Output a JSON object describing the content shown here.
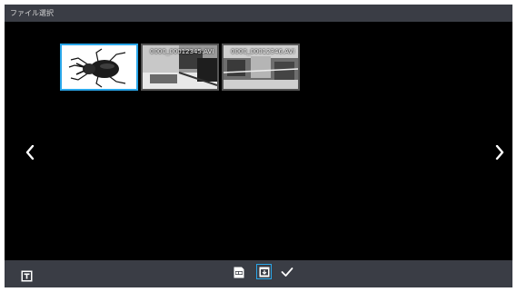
{
  "window": {
    "title": "ファイル選択"
  },
  "thumbnails": [
    {
      "name": "beetle",
      "caption": "",
      "selected": true
    },
    {
      "name": "video-1",
      "caption": "0000_00012345.AVI",
      "selected": false
    },
    {
      "name": "video-2",
      "caption": "0000_00012346.AVI",
      "selected": false
    }
  ],
  "toolbar": {
    "text_icon": "text-mode-icon",
    "sd_icon": "sd-card-icon",
    "import_icon": "internal-storage-icon",
    "confirm_icon": "check-icon"
  },
  "colors": {
    "accent": "#2aa7ea",
    "bar": "#3a3d45",
    "background": "#000000"
  }
}
